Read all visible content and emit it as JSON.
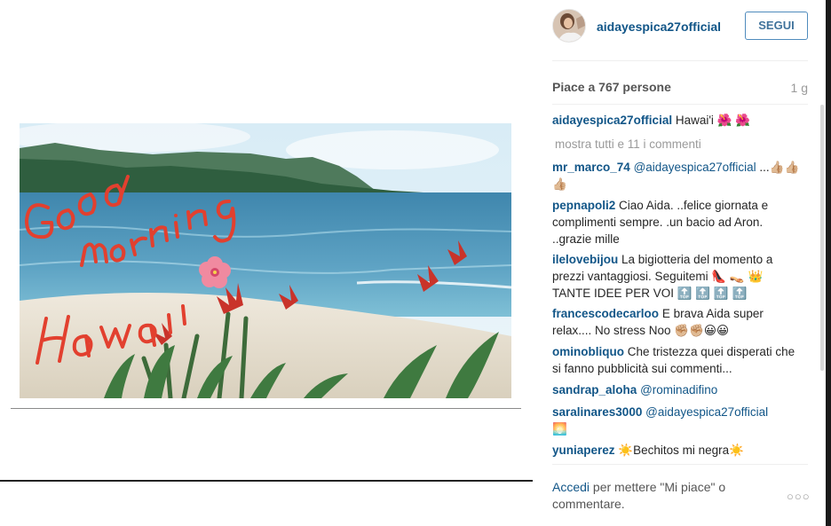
{
  "post": {
    "image_alt": "Good morning Hawaii photo",
    "image_caption_handwritten": "Good morning Hawaii"
  },
  "header": {
    "username": "aidayespica27official",
    "follow_label": "SEGUI"
  },
  "stats": {
    "likes": "Piace a 767 persone",
    "time": "1 g"
  },
  "comments": [
    {
      "user": "aidayespica27official",
      "text": "Hawai'i 🌺 🌺"
    },
    {
      "user": "",
      "text": "mostra tutti e 11 i commenti"
    },
    {
      "user": "mr_marco_74",
      "mention": "@aidayespica27official",
      "text": "...👍🏼👍🏼👍🏼"
    },
    {
      "user": "pepnapoli2",
      "text": "Ciao Aida. ..felice giornata e complimenti sempre. .un bacio ad Aron. ..grazie mille"
    },
    {
      "user": "ilelovebijou",
      "text": "La bigiotteria del momento a prezzi vantaggiosi. Seguitemi 👠 👡 👑 TANTE IDEE PER VOI 🔝 🔝 🔝 🔝"
    },
    {
      "user": "francescodecarloo",
      "text": "E brava Aida super relax.... No stress Noo ✊🏼✊🏼😀😀"
    },
    {
      "user": "ominobliquo",
      "text": "Che tristezza quei disperati che si fanno pubblicità sui commenti..."
    },
    {
      "user": "sandrap_aloha",
      "mention": "@rominadifino",
      "text": ""
    },
    {
      "user": "saralinares3000",
      "mention": "@aidayespica27official",
      "text": "🌅"
    },
    {
      "user": "yuniaperez",
      "text": "☀️Bechitos mi negra☀️"
    }
  ],
  "footer": {
    "login_link": "Accedi",
    "login_text": " per mettere \"Mi piace\" o commentare.",
    "more_icon": "ellipsis-icon"
  },
  "colors": {
    "username_blue": "#125688",
    "button_blue": "#3f729b",
    "text": "#262626",
    "muted": "#9a9a9a"
  }
}
